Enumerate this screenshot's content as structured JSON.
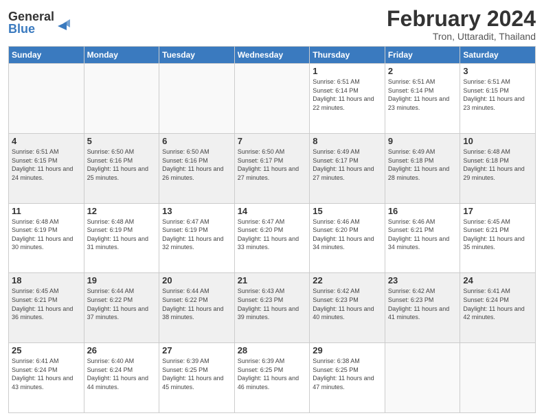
{
  "header": {
    "logo_line1": "General",
    "logo_line2": "Blue",
    "month_year": "February 2024",
    "location": "Tron, Uttaradit, Thailand"
  },
  "days_of_week": [
    "Sunday",
    "Monday",
    "Tuesday",
    "Wednesday",
    "Thursday",
    "Friday",
    "Saturday"
  ],
  "weeks": [
    [
      null,
      null,
      null,
      null,
      {
        "day": 1,
        "sunrise": "6:51 AM",
        "sunset": "6:14 PM",
        "daylight": "11 hours and 22 minutes."
      },
      {
        "day": 2,
        "sunrise": "6:51 AM",
        "sunset": "6:14 PM",
        "daylight": "11 hours and 23 minutes."
      },
      {
        "day": 3,
        "sunrise": "6:51 AM",
        "sunset": "6:15 PM",
        "daylight": "11 hours and 23 minutes."
      }
    ],
    [
      {
        "day": 4,
        "sunrise": "6:51 AM",
        "sunset": "6:15 PM",
        "daylight": "11 hours and 24 minutes."
      },
      {
        "day": 5,
        "sunrise": "6:50 AM",
        "sunset": "6:16 PM",
        "daylight": "11 hours and 25 minutes."
      },
      {
        "day": 6,
        "sunrise": "6:50 AM",
        "sunset": "6:16 PM",
        "daylight": "11 hours and 26 minutes."
      },
      {
        "day": 7,
        "sunrise": "6:50 AM",
        "sunset": "6:17 PM",
        "daylight": "11 hours and 27 minutes."
      },
      {
        "day": 8,
        "sunrise": "6:49 AM",
        "sunset": "6:17 PM",
        "daylight": "11 hours and 27 minutes."
      },
      {
        "day": 9,
        "sunrise": "6:49 AM",
        "sunset": "6:18 PM",
        "daylight": "11 hours and 28 minutes."
      },
      {
        "day": 10,
        "sunrise": "6:48 AM",
        "sunset": "6:18 PM",
        "daylight": "11 hours and 29 minutes."
      }
    ],
    [
      {
        "day": 11,
        "sunrise": "6:48 AM",
        "sunset": "6:19 PM",
        "daylight": "11 hours and 30 minutes."
      },
      {
        "day": 12,
        "sunrise": "6:48 AM",
        "sunset": "6:19 PM",
        "daylight": "11 hours and 31 minutes."
      },
      {
        "day": 13,
        "sunrise": "6:47 AM",
        "sunset": "6:19 PM",
        "daylight": "11 hours and 32 minutes."
      },
      {
        "day": 14,
        "sunrise": "6:47 AM",
        "sunset": "6:20 PM",
        "daylight": "11 hours and 33 minutes."
      },
      {
        "day": 15,
        "sunrise": "6:46 AM",
        "sunset": "6:20 PM",
        "daylight": "11 hours and 34 minutes."
      },
      {
        "day": 16,
        "sunrise": "6:46 AM",
        "sunset": "6:21 PM",
        "daylight": "11 hours and 34 minutes."
      },
      {
        "day": 17,
        "sunrise": "6:45 AM",
        "sunset": "6:21 PM",
        "daylight": "11 hours and 35 minutes."
      }
    ],
    [
      {
        "day": 18,
        "sunrise": "6:45 AM",
        "sunset": "6:21 PM",
        "daylight": "11 hours and 36 minutes."
      },
      {
        "day": 19,
        "sunrise": "6:44 AM",
        "sunset": "6:22 PM",
        "daylight": "11 hours and 37 minutes."
      },
      {
        "day": 20,
        "sunrise": "6:44 AM",
        "sunset": "6:22 PM",
        "daylight": "11 hours and 38 minutes."
      },
      {
        "day": 21,
        "sunrise": "6:43 AM",
        "sunset": "6:23 PM",
        "daylight": "11 hours and 39 minutes."
      },
      {
        "day": 22,
        "sunrise": "6:42 AM",
        "sunset": "6:23 PM",
        "daylight": "11 hours and 40 minutes."
      },
      {
        "day": 23,
        "sunrise": "6:42 AM",
        "sunset": "6:23 PM",
        "daylight": "11 hours and 41 minutes."
      },
      {
        "day": 24,
        "sunrise": "6:41 AM",
        "sunset": "6:24 PM",
        "daylight": "11 hours and 42 minutes."
      }
    ],
    [
      {
        "day": 25,
        "sunrise": "6:41 AM",
        "sunset": "6:24 PM",
        "daylight": "11 hours and 43 minutes."
      },
      {
        "day": 26,
        "sunrise": "6:40 AM",
        "sunset": "6:24 PM",
        "daylight": "11 hours and 44 minutes."
      },
      {
        "day": 27,
        "sunrise": "6:39 AM",
        "sunset": "6:25 PM",
        "daylight": "11 hours and 45 minutes."
      },
      {
        "day": 28,
        "sunrise": "6:39 AM",
        "sunset": "6:25 PM",
        "daylight": "11 hours and 46 minutes."
      },
      {
        "day": 29,
        "sunrise": "6:38 AM",
        "sunset": "6:25 PM",
        "daylight": "11 hours and 47 minutes."
      },
      null,
      null
    ]
  ]
}
